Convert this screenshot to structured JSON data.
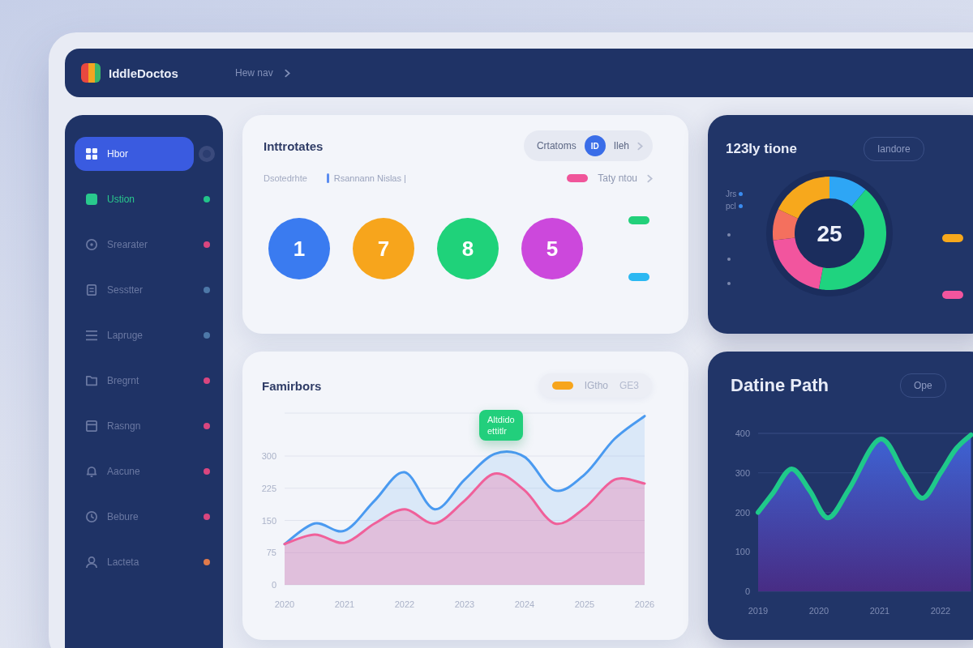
{
  "header": {
    "title": "IddleDoctos",
    "breadcrumb": "Hew nav"
  },
  "sidebar": {
    "items": [
      {
        "label": "Hbor",
        "selected": true,
        "highlighted": false
      },
      {
        "label": "Ustion",
        "selected": false,
        "highlighted": true,
        "color": "#22c48a"
      },
      {
        "label": "Srearater",
        "selected": false,
        "highlighted": false,
        "color": "#d9467f"
      },
      {
        "label": "Sesstter",
        "selected": false,
        "highlighted": false,
        "color": "#4d78a8"
      },
      {
        "label": "Lapruge",
        "selected": false,
        "highlighted": false,
        "color": "#4d78a8"
      },
      {
        "label": "Bregrnt",
        "selected": false,
        "highlighted": false,
        "color": "#d9467f"
      },
      {
        "label": "Rasngn",
        "selected": false,
        "highlighted": false,
        "color": "#d9467f"
      },
      {
        "label": "Aacune",
        "selected": false,
        "highlighted": false,
        "color": "#d9467f"
      },
      {
        "label": "Bebure",
        "selected": false,
        "highlighted": false,
        "color": "#d9467f"
      },
      {
        "label": "Lacteta",
        "selected": false,
        "highlighted": false,
        "color": "#e07a4a"
      }
    ]
  },
  "summary_card": {
    "title": "Inttrotates",
    "subtitle": "Dsotedrhte",
    "tag": "Rsannann Nislas |",
    "toggle": {
      "left": "Crtatoms",
      "badge": "ID",
      "right": "Ileh"
    },
    "legend": [
      {
        "label": "Taty ntou",
        "color": "#f0559a"
      },
      {
        "color": "#22d07a"
      },
      {
        "color": "#2bb8f2"
      }
    ],
    "counters": [
      {
        "value": "1",
        "color": "#3a7bf0"
      },
      {
        "value": "7",
        "color": "#f7a51c"
      },
      {
        "value": "8",
        "color": "#1fd27a"
      },
      {
        "value": "5",
        "color": "#cc48dc"
      }
    ]
  },
  "breakdown_card": {
    "title": "123Iy tione",
    "button": "Iandore",
    "legend": [
      {
        "label": "Jrs"
      },
      {
        "label": "pcl"
      }
    ],
    "total": "25",
    "swatches": [
      {
        "color": "#f7a81c"
      },
      {
        "color": "#f2559e"
      }
    ],
    "chart_data": {
      "type": "donut",
      "values": [
        11,
        42,
        20,
        9,
        18
      ],
      "colors": [
        "#2ea6f5",
        "#1fd37f",
        "#f2559e",
        "#f4705e",
        "#f7a81c"
      ]
    }
  },
  "trend_card": {
    "title": "Famirbors",
    "legend": {
      "color": "#f7a51c",
      "label": "IGtho",
      "value": "GE3"
    },
    "tooltip": {
      "lines": [
        "Altdido",
        "ettitlr"
      ]
    },
    "chart_data": {
      "type": "area",
      "x": [
        2020,
        2020.5,
        2021,
        2021.5,
        2022,
        2022.5,
        2023,
        2023.5,
        2024,
        2024.5,
        2025,
        2025.5,
        2026
      ],
      "xlim": [
        2020,
        2026
      ],
      "xticks": [
        2020,
        2021,
        2022,
        2023,
        2024,
        2025,
        2026
      ],
      "yticks": [
        0,
        75,
        150,
        225,
        300
      ],
      "ylim": [
        0,
        400
      ],
      "grid": true,
      "series": [
        {
          "color": "#4a9af0",
          "values": [
            95,
            143,
            126,
            196,
            262,
            176,
            245,
            305,
            298,
            220,
            257,
            340,
            393
          ]
        },
        {
          "color": "#f0609a",
          "values": [
            95,
            117,
            98,
            143,
            176,
            143,
            196,
            259,
            220,
            143,
            179,
            245,
            236
          ]
        }
      ]
    }
  },
  "path_card": {
    "title": "Datine Path",
    "button": "Ope",
    "chart_data": {
      "type": "area",
      "x": [
        2019,
        2019.25,
        2019.55,
        2019.85,
        2020.15,
        2020.5,
        2021,
        2021.4,
        2021.7,
        2022,
        2022.25,
        2022.5
      ],
      "xlim": [
        2019,
        2022.5
      ],
      "xticks": [
        2019,
        2020,
        2021,
        2022
      ],
      "yticks": [
        0,
        100,
        200,
        300,
        400
      ],
      "ylim": [
        0,
        400
      ],
      "grid": true,
      "series": [
        {
          "color": "#1fc98a",
          "values": [
            200,
            250,
            310,
            255,
            186,
            260,
            385,
            300,
            236,
            300,
            360,
            396
          ]
        }
      ]
    }
  }
}
